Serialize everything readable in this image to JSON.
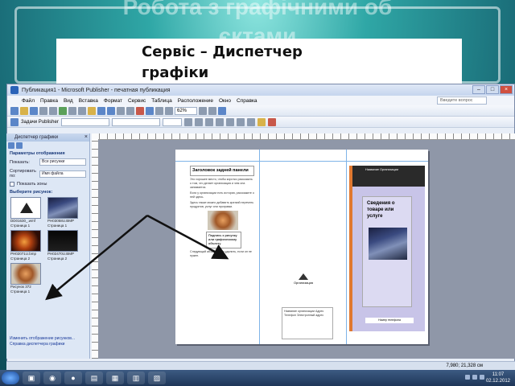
{
  "slide": {
    "title_line1": "Робота з графічними об",
    "title_line2": "єктами",
    "caption_line1": "Сервіс – Диспетчер",
    "caption_line2": "графіки"
  },
  "window": {
    "title": "Публикация1 - Microsoft Publisher - печатная публикация",
    "menu": [
      "Файл",
      "Правка",
      "Вид",
      "Вставка",
      "Формат",
      "Сервис",
      "Таблица",
      "Расположение",
      "Окно",
      "Справка"
    ],
    "help_placeholder": "Введите вопрос",
    "zoom": "62%",
    "tasks_label": "Задачи Publisher"
  },
  "pane": {
    "title": "Диспетчер графики",
    "params_heading": "Параметры отображения",
    "show_label": "Показать:",
    "show_value": "Все рисунки",
    "sort_label": "Сортировать по:",
    "sort_value": "Имя файла",
    "show_zoom_label": "Показать зоны",
    "select_heading": "Выберите рисунок:",
    "thumbs": [
      {
        "caption": "DD01630_.wmf Страница 1",
        "kind": "logo"
      },
      {
        "caption": "PH03058U.BMP Страница 1",
        "kind": "city"
      },
      {
        "caption": "PH02071U.bmp Страница 2",
        "kind": "fire"
      },
      {
        "caption": "PH02470U.BMP Страница 2",
        "kind": "dark"
      },
      {
        "caption": "Рисунок 372 Страница 1",
        "kind": "food"
      }
    ],
    "footer_link1": "Изменить отображение рисунков...",
    "footer_link2": "Справка диспетчера графики"
  },
  "document": {
    "col1_heading": "Заголовок задней панели",
    "col1_p1": "Это хорошее место, чтобы коротко рассказать о том, что делает организация и чем она занимается.",
    "col1_p2": "Если у организации есть история, расскажите о ней здесь.",
    "col1_p3": "Здесь также можно добавить краткий перечень продуктов, услуг или программ.",
    "col1_box": "Подпись к рисунку или графическому объекту",
    "col1_p4": "Следующий абзац можно удалить, если он не нужен.",
    "col2_logo": "Организация",
    "col2_addr": "Название организации Адрес Телефон Электронный адрес",
    "col3_top": "Название Организации",
    "col3_title": "Сведения о товаре или услуге",
    "col3_footer": "Номер телефона"
  },
  "pages": [
    "1",
    "2"
  ],
  "status": {
    "coords": "7,980; 21,328 см"
  },
  "taskbar": {
    "time": "11:07",
    "date": "02.12.2012"
  }
}
